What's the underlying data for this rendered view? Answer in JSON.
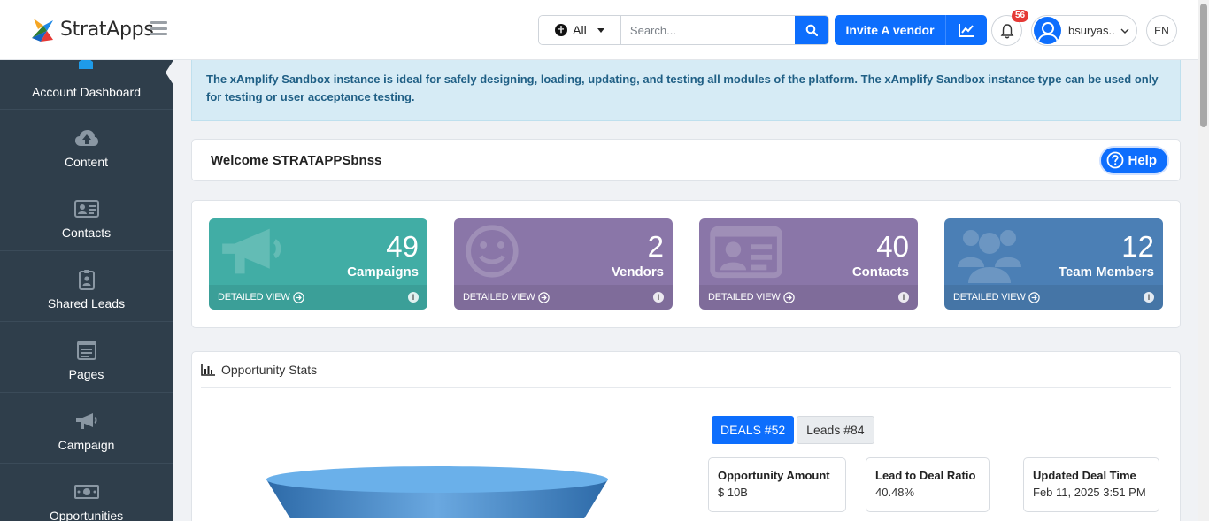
{
  "header": {
    "logo_text": "StratApps",
    "search": {
      "scope": "All",
      "placeholder": "Search..."
    },
    "invite_label": "Invite A vendor",
    "notification_count": "56",
    "user_name": "bsuryas..",
    "language": "EN"
  },
  "sidebar": {
    "items": [
      {
        "label": "Account Dashboard",
        "icon": "home-icon"
      },
      {
        "label": "Content",
        "icon": "cloud-upload-icon"
      },
      {
        "label": "Contacts",
        "icon": "contact-card-icon"
      },
      {
        "label": "Shared Leads",
        "icon": "badge-icon"
      },
      {
        "label": "Pages",
        "icon": "page-icon"
      },
      {
        "label": "Campaign",
        "icon": "megaphone-icon"
      },
      {
        "label": "Opportunities",
        "icon": "money-icon"
      }
    ]
  },
  "alert": {
    "text": "The xAmplify Sandbox instance is ideal for safely designing, loading, updating, and testing all modules of the platform. The xAmplify Sandbox instance type can be used only for testing or user acceptance testing."
  },
  "welcome": {
    "text": "Welcome STRATAPPSbnss",
    "help_label": "Help"
  },
  "cards": [
    {
      "value": "49",
      "label": "Campaigns",
      "footer": "DETAILED VIEW",
      "color": "#41ada5",
      "icon": "megaphone-icon"
    },
    {
      "value": "2",
      "label": "Vendors",
      "footer": "DETAILED VIEW",
      "color": "#8a76a8",
      "icon": "smiley-icon"
    },
    {
      "value": "40",
      "label": "Contacts",
      "footer": "DETAILED VIEW",
      "color": "#8a76a8",
      "icon": "contact-card-icon"
    },
    {
      "value": "12",
      "label": "Team Members",
      "footer": "DETAILED VIEW",
      "color": "#4b7fb5",
      "icon": "users-icon"
    }
  ],
  "stats": {
    "title": "Opportunity Stats",
    "tabs": [
      "DEALS #52",
      "Leads #84"
    ],
    "active_tab": 0,
    "metrics": [
      {
        "label": "Opportunity Amount",
        "value": "$ 10B"
      },
      {
        "label": "Lead to Deal Ratio",
        "value": "40.48%"
      },
      {
        "label": "Updated Deal Time",
        "value": "Feb 11, 2025 3:51 PM"
      }
    ]
  },
  "colors": {
    "primary": "#0d6efd",
    "sidebar": "#2f3e4b",
    "alert_bg": "#d6ebf5",
    "badge": "#e53935"
  }
}
